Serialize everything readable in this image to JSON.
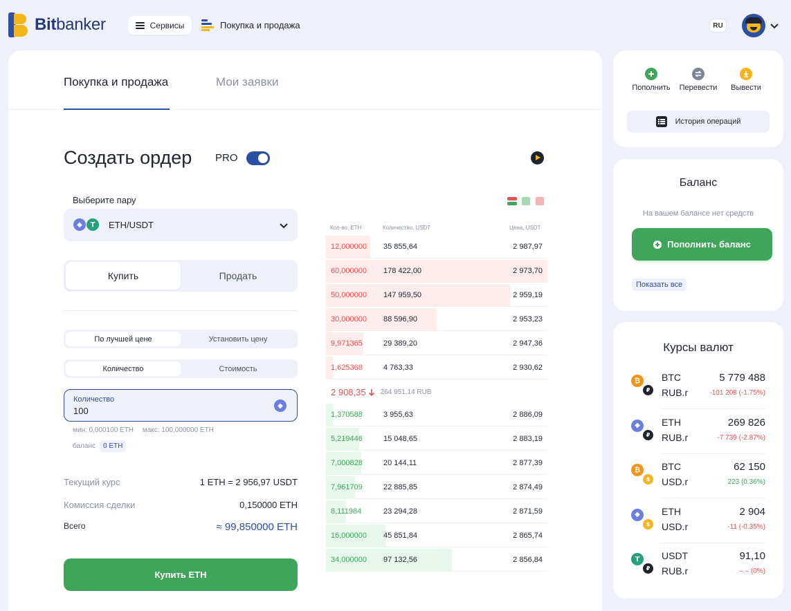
{
  "header": {
    "logo_bold": "Bit",
    "logo_rest": "banker",
    "services_label": "Сервисы",
    "nav_title": "Покупка и продажа",
    "lang": "RU"
  },
  "tabs": [
    {
      "label": "Покупка и продажа",
      "active": true
    },
    {
      "label": "Мои заявки",
      "active": false
    }
  ],
  "order": {
    "title": "Создать ордер",
    "pro_label": "PRO",
    "pro_enabled": true,
    "pair_label": "Выберите пару",
    "pair_value": "ETH/USDT",
    "side_options": [
      "Купить",
      "Продать"
    ],
    "price_mode_options": [
      "По лучшей цене",
      "Установить цену"
    ],
    "amount_mode_options": [
      "Количество",
      "Стоимость"
    ],
    "qty_label": "Количество",
    "qty_value": "100",
    "min_text": "мин: 0,000100 ETH",
    "max_text": "макс: 100,000000 ETH",
    "balance_label": "баланс",
    "balance_value": "0 ETH",
    "rate_label": "Текущий курс",
    "rate_value": "1 ETH = 2 956,97 USDT",
    "fee_label": "Комиссия сделки",
    "fee_value": "0,150000 ETH",
    "total_label": "Всего",
    "total_value": "≈ 99,850000 ETH",
    "buy_button": "Купить ETH"
  },
  "orderbook": {
    "col_amount": "Кол-во, ETH",
    "col_qty": "Количество, USDT",
    "col_price": "Цена, USDT",
    "asks": [
      {
        "amount": "12,000000",
        "qty": "35 855,64",
        "price": "2 987,97",
        "depth": 0.2
      },
      {
        "amount": "60,000000",
        "qty": "178 422,00",
        "price": "2 973,70",
        "depth": 1.0
      },
      {
        "amount": "50,000000",
        "qty": "147 959,50",
        "price": "2 959,19",
        "depth": 0.83
      },
      {
        "amount": "30,000000",
        "qty": "88 596,90",
        "price": "2 953,23",
        "depth": 0.5
      },
      {
        "amount": "9,971365",
        "qty": "29 389,20",
        "price": "2 947,36",
        "depth": 0.17
      },
      {
        "amount": "1,625368",
        "qty": "4 763,33",
        "price": "2 930,62",
        "depth": 0.03
      }
    ],
    "mid_price": "2 908,35",
    "mid_rub": "264 951,14 RUB",
    "bids": [
      {
        "amount": "1,370588",
        "qty": "3 955,63",
        "price": "2 886,09",
        "depth": 0.03
      },
      {
        "amount": "5,219446",
        "qty": "15 048,65",
        "price": "2 883,19",
        "depth": 0.15
      },
      {
        "amount": "7,000828",
        "qty": "20 144,11",
        "price": "2 877,39",
        "depth": 0.16
      },
      {
        "amount": "7,961709",
        "qty": "22 885,85",
        "price": "2 874,49",
        "depth": 0.13
      },
      {
        "amount": "8,111984",
        "qty": "23 294,28",
        "price": "2 871,59",
        "depth": 0.09
      },
      {
        "amount": "16,000000",
        "qty": "45 851,84",
        "price": "2 865,74",
        "depth": 0.27
      },
      {
        "amount": "34,000000",
        "qty": "97 132,56",
        "price": "2 856,84",
        "depth": 0.57
      }
    ]
  },
  "actions": [
    {
      "label": "Пополнить",
      "color": "#3fa55b",
      "icon": "plus-icon"
    },
    {
      "label": "Перевести",
      "color": "#7d8597",
      "icon": "transfer-icon"
    },
    {
      "label": "Вывести",
      "color": "#f5b51c",
      "icon": "withdraw-icon"
    }
  ],
  "history_label": "История операций",
  "balance": {
    "title": "Баланс",
    "empty_text": "На вашем балансе нет средств",
    "topup_button": "Пополнить баланс",
    "show_all": "Показать все"
  },
  "rates": {
    "title": "Курсы валют",
    "items": [
      {
        "base": "BTC",
        "quote": "RUB.r",
        "value": "5 779 488",
        "change": "-101 208 (-1.75%)",
        "trend": "neg",
        "base_coin": "btc",
        "quote_coin": "rub"
      },
      {
        "base": "ETH",
        "quote": "RUB.r",
        "value": "269 826",
        "change": "-7 739 (-2.87%)",
        "trend": "neg",
        "base_coin": "eth",
        "quote_coin": "rub"
      },
      {
        "base": "BTC",
        "quote": "USD.r",
        "value": "62 150",
        "change": "223 (0.36%)",
        "trend": "pos",
        "base_coin": "btc",
        "quote_coin": "usd"
      },
      {
        "base": "ETH",
        "quote": "USD.r",
        "value": "2 904",
        "change": "-11 (-0.35%)",
        "trend": "neg",
        "base_coin": "eth",
        "quote_coin": "usd"
      },
      {
        "base": "USDT",
        "quote": "RUB.r",
        "value": "91,10",
        "change": "–.– (0%)",
        "trend": "neg",
        "base_coin": "usdt",
        "quote_coin": "rub"
      }
    ]
  }
}
